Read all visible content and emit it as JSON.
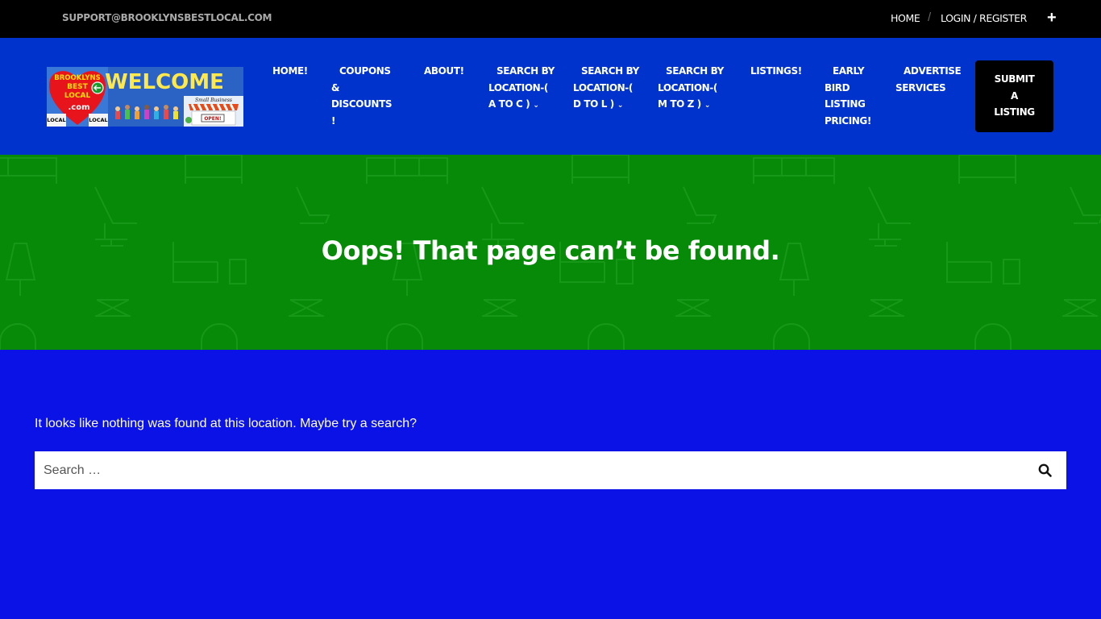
{
  "topbar": {
    "email": "SUPPORT@BROOKLYNSBESTLOCAL.COM",
    "home": "HOME",
    "separator": "/",
    "login": "LOGIN / REGISTER",
    "plus_icon": "plus-icon"
  },
  "logo": {
    "heart_line1": "BROOKLYNS",
    "heart_line2": "BEST",
    "heart_line3": "LOCAL",
    "heart_line4": ".com",
    "welcome": "WELCOME",
    "sign_small": "Small Business",
    "sign_open": "OPEN!",
    "local_left": "LOCAL",
    "local_right": "LOCAL"
  },
  "nav": {
    "home": "HOME!",
    "coupons_1": "COUPONS",
    "coupons_2": "&",
    "coupons_3": "DISCOUNTS",
    "coupons_4": "!",
    "about": "ABOUT!",
    "a_to_c_1": "SEARCH BY",
    "a_to_c_2": "LOCATION-(",
    "a_to_c_3": "A TO C )",
    "d_to_l_1": "SEARCH BY",
    "d_to_l_2": "LOCATION-(",
    "d_to_l_3": "D TO L )",
    "m_to_z_1": "SEARCH BY",
    "m_to_z_2": "LOCATION-(",
    "m_to_z_3": "M TO Z )",
    "listings": "LISTINGS!",
    "early_1": "EARLY",
    "early_2": "BIRD",
    "early_3": "LISTING",
    "early_4": "PRICING!",
    "advertise_1": "ADVERTISE",
    "advertise_2": "SERVICES",
    "submit_1": "SUBMIT",
    "submit_2": "A",
    "submit_3": "LISTING",
    "caret_icon": "chevron-down-icon"
  },
  "hero": {
    "title": "Oops! That page can’t be found."
  },
  "content": {
    "message": "It looks like nothing was found at this location. Maybe try a search?",
    "search_placeholder": "Search …",
    "search_icon": "search-icon"
  },
  "colors": {
    "topbar_bg": "#000000",
    "header_bg": "#0033cc",
    "hero_bg": "#078a07",
    "body_bg": "#0a12e6",
    "submit_bg": "#000000"
  }
}
